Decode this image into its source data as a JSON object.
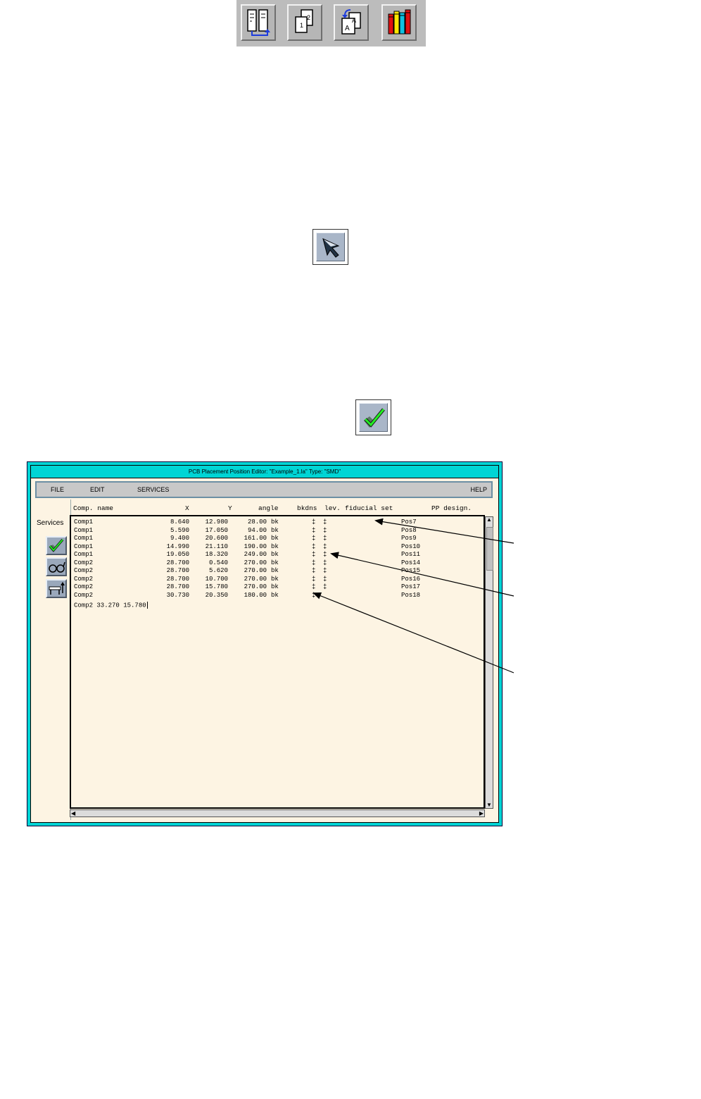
{
  "toolbar": {
    "buttons": [
      {
        "icon": "placement-list-icon"
      },
      {
        "icon": "copy-pages-icon"
      },
      {
        "icon": "replace-text-icon"
      },
      {
        "icon": "library-books-icon"
      }
    ]
  },
  "icons": {
    "pointer": "select-arrow-icon",
    "check": "check-icon"
  },
  "window": {
    "title": "PCB Placement Position Editor: \"Example_1.la\"   Type: \"SMD\"",
    "menu": {
      "file": "FILE",
      "edit": "EDIT",
      "services": "SERVICES",
      "help": "HELP"
    },
    "side_label": "Services",
    "columns": {
      "name": "Comp. name",
      "x": "X",
      "y": "Y",
      "angle": "angle",
      "bkdns": "bkdns",
      "lev": "lev.",
      "fiducial": "fiducial set",
      "pp": "PP design."
    },
    "rows": [
      {
        "name": "Comp1",
        "x": "8.640",
        "y": "12.980",
        "angle": "28.00",
        "bk": "bk",
        "f1": "‡",
        "f2": "‡",
        "pos": "Pos7"
      },
      {
        "name": "Comp1",
        "x": "5.590",
        "y": "17.050",
        "angle": "94.00",
        "bk": "bk",
        "f1": "‡",
        "f2": "‡",
        "pos": "Pos8"
      },
      {
        "name": "Comp1",
        "x": "9.400",
        "y": "20.600",
        "angle": "161.00",
        "bk": "bk",
        "f1": "‡",
        "f2": "‡",
        "pos": "Pos9"
      },
      {
        "name": "Comp1",
        "x": "14.990",
        "y": "21.110",
        "angle": "190.00",
        "bk": "bk",
        "f1": "‡",
        "f2": "‡",
        "pos": "Pos10"
      },
      {
        "name": "Comp1",
        "x": "19.050",
        "y": "18.320",
        "angle": "249.00",
        "bk": "bk",
        "f1": "‡",
        "f2": "‡",
        "pos": "Pos11"
      },
      {
        "name": "Comp2",
        "x": "28.700",
        "y": "0.540",
        "angle": "270.00",
        "bk": "bk",
        "f1": "‡",
        "f2": "‡",
        "pos": "Pos14"
      },
      {
        "name": "Comp2",
        "x": "28.700",
        "y": "5.620",
        "angle": "270.00",
        "bk": "bk",
        "f1": "‡",
        "f2": "‡",
        "pos": "Pos15"
      },
      {
        "name": "Comp2",
        "x": "28.700",
        "y": "10.700",
        "angle": "270.00",
        "bk": "bk",
        "f1": "‡",
        "f2": "‡",
        "pos": "Pos16"
      },
      {
        "name": "Comp2",
        "x": "28.700",
        "y": "15.780",
        "angle": "270.00",
        "bk": "bk",
        "f1": "‡",
        "f2": "‡",
        "pos": "Pos17"
      },
      {
        "name": "Comp2",
        "x": "30.730",
        "y": "20.350",
        "angle": "180.00",
        "bk": "bk",
        "f1": "‡",
        "f2": "",
        "pos": "Pos18"
      }
    ],
    "input_line": "Comp2 33.270 15.780"
  }
}
